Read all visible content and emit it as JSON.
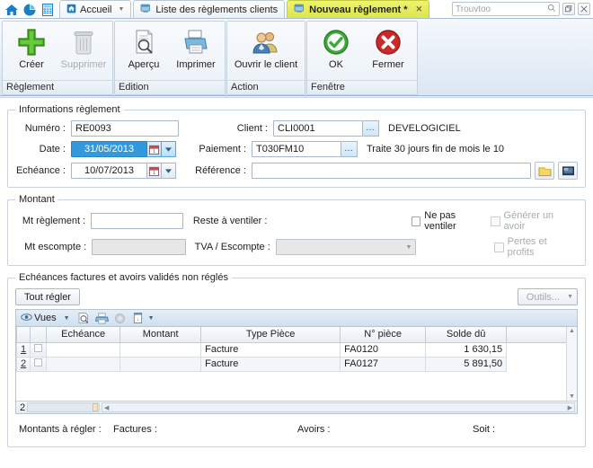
{
  "titlebar": {
    "quick_icons": [
      "home-icon",
      "pie-chart-icon",
      "spreadsheet-icon"
    ],
    "tabs": [
      {
        "label": "Accueil",
        "icon": "home-icon",
        "active": false,
        "has_caret": true
      },
      {
        "label": "Liste des règlements clients",
        "icon": "window-icon",
        "active": false
      },
      {
        "label": "Nouveau règlement *",
        "icon": "window-icon",
        "active": true,
        "close": "×"
      }
    ],
    "search": {
      "placeholder": "Trouvtoo",
      "icon": "search-icon"
    },
    "window_buttons": [
      "restore-icon",
      "close-icon"
    ]
  },
  "ribbon": {
    "groups": [
      {
        "title": "Règlement",
        "items": [
          {
            "label": "Créer",
            "icon": "plus-icon",
            "disabled": false
          },
          {
            "label": "Supprimer",
            "icon": "trash-icon",
            "disabled": true
          }
        ]
      },
      {
        "title": "Edition",
        "items": [
          {
            "label": "Aperçu",
            "icon": "preview-icon",
            "disabled": false
          },
          {
            "label": "Imprimer",
            "icon": "printer-icon",
            "disabled": false
          }
        ]
      },
      {
        "title": "Action",
        "items": [
          {
            "label": "Ouvrir le client",
            "icon": "users-icon",
            "disabled": false
          }
        ]
      },
      {
        "title": "Fenêtre",
        "items": [
          {
            "label": "OK",
            "icon": "check-icon",
            "disabled": false
          },
          {
            "label": "Fermer",
            "icon": "cancel-icon",
            "disabled": false
          }
        ]
      }
    ]
  },
  "info": {
    "legend": "Informations règlement",
    "numero_label": "Numéro :",
    "numero_value": "RE0093",
    "date_label": "Date :",
    "date_value": "31/05/2013",
    "echeance_label": "Echéance :",
    "echeance_value": "10/07/2013",
    "client_label": "Client :",
    "client_value": "CLI0001",
    "client_name": "DEVELOGICIEL",
    "paiement_label": "Paiement :",
    "paiement_value": "T030FM10",
    "paiement_desc": "Traite 30 jours fin de mois le 10",
    "reference_label": "Référence :",
    "reference_value": "",
    "note_button_icon": "yellow-note-icon",
    "screen_button_icon": "monitor-icon"
  },
  "montant": {
    "legend": "Montant",
    "mt_reglement_label": "Mt règlement :",
    "mt_reglement_value": "",
    "mt_escompte_label": "Mt escompte :",
    "mt_escompte_value": "",
    "reste_label": "Reste à ventiler :",
    "reste_value": "",
    "tva_label": "TVA / Escompte :",
    "tva_value": "",
    "cb_ne_pas_ventiler": "Ne pas ventiler",
    "cb_generer_avoir": "Générer un avoir",
    "cb_pertes_profits": "Pertes et profits"
  },
  "echeances": {
    "legend": "Echéances factures et avoirs validés non réglés",
    "tout_regler": "Tout régler",
    "outils": "Outils...",
    "toolbar": {
      "vues": "Vues",
      "icons": [
        "eye-icon",
        "chevron-down-icon",
        "preview-icon",
        "print-icon",
        "disabled-circle-icon",
        "export-doc-icon",
        "chevron-down-icon"
      ]
    },
    "columns": [
      "",
      "",
      "Echéance",
      "Montant",
      "Type Pièce",
      "N° pièce",
      "Solde dû"
    ],
    "rows": [
      {
        "num": "1",
        "echeance": "",
        "montant": "",
        "type": "Facture",
        "piece": "FA0120",
        "solde": "1 630,15"
      },
      {
        "num": "2",
        "echeance": "",
        "montant": "",
        "type": "Facture",
        "piece": "FA0127",
        "solde": "5 891,50"
      }
    ],
    "row_count": "2"
  },
  "totals": {
    "montants_label": "Montants à régler :",
    "factures_label": "Factures :",
    "factures_value": "",
    "avoirs_label": "Avoirs :",
    "avoirs_value": "",
    "soit_label": "Soit :",
    "soit_value": ""
  },
  "colors": {
    "accent_blue": "#1b7fc4",
    "active_tab": "#dce64b",
    "selection": "#3399dd"
  }
}
